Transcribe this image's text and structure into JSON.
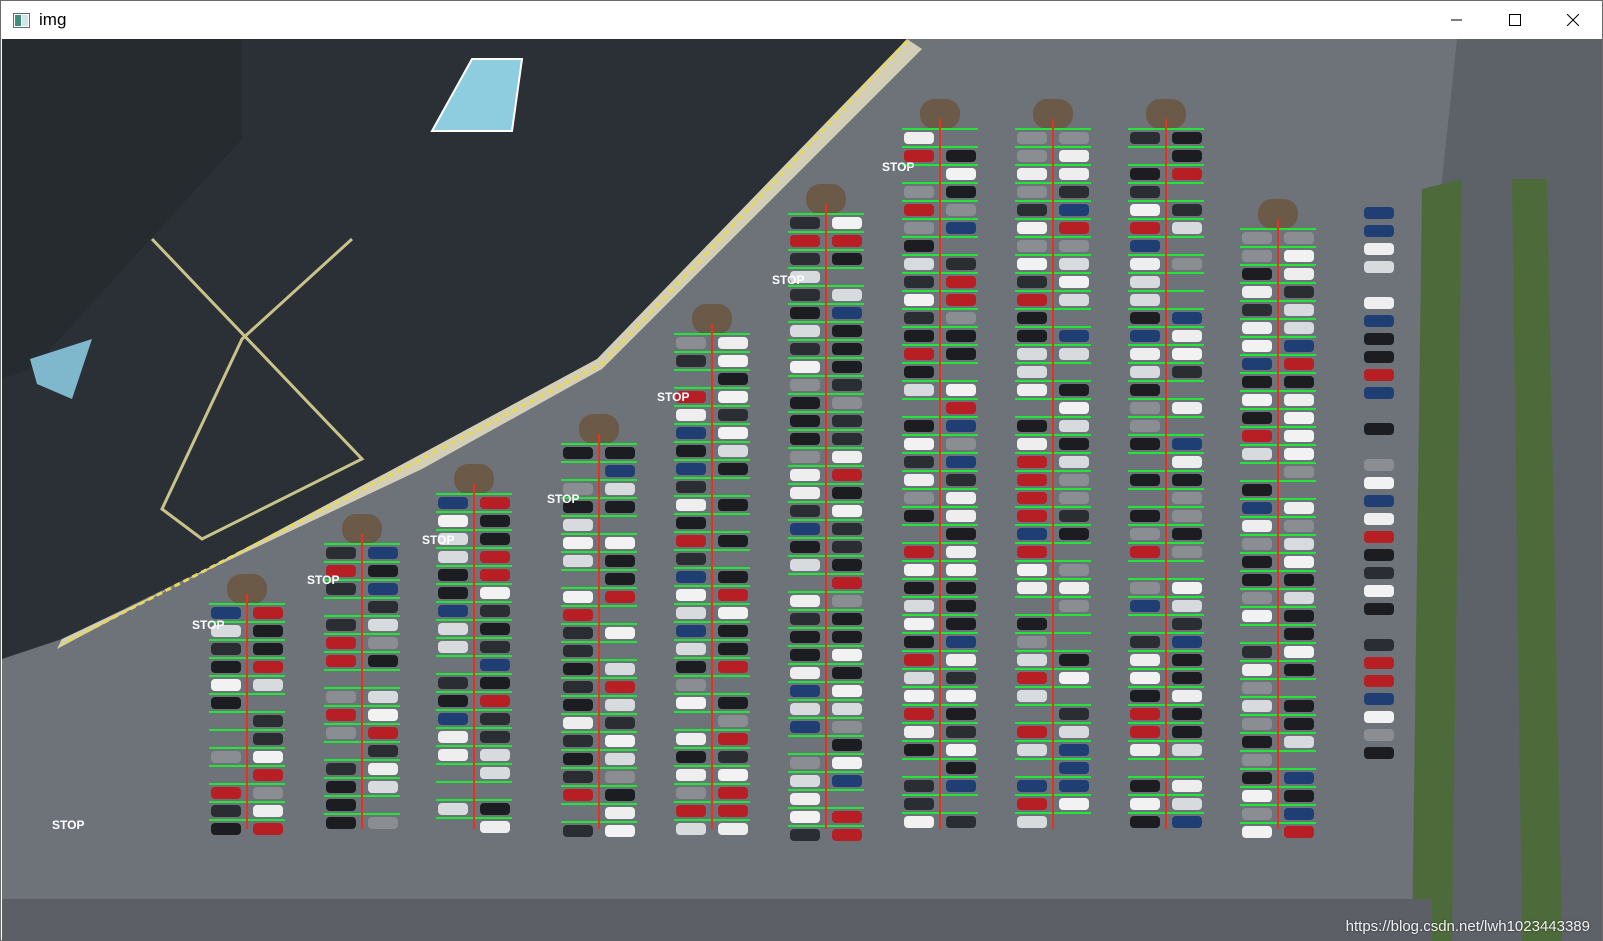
{
  "window": {
    "title": "img",
    "icon": "image-app-icon",
    "controls": [
      "minimize-icon",
      "maximize-icon",
      "close-icon"
    ]
  },
  "image": {
    "watermark": "https://blog.csdn.net/lwh1023443389",
    "road_markings": [
      "STOP",
      "STOP",
      "STOP",
      "STOP",
      "STOP",
      "STOP",
      "STOP",
      "STOP"
    ]
  },
  "colors": {
    "asphalt": "#6e737a",
    "roof": "#2b3036",
    "detection_line": "#22e53a",
    "lane_line": "#e8321e",
    "grass": "#4d6b3a",
    "road": "#5d6268"
  }
}
